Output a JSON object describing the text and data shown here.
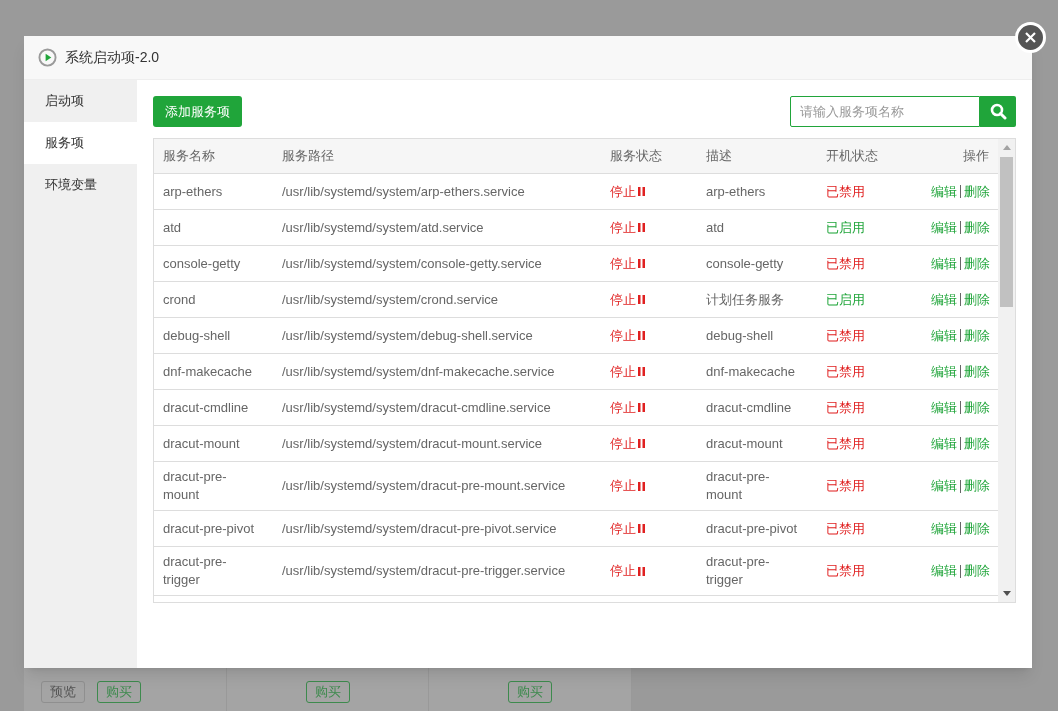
{
  "background": {
    "cards": [
      {
        "buttons": [
          {
            "label": "预览",
            "kind": "plain"
          },
          {
            "label": "购买",
            "kind": "buy"
          }
        ]
      },
      {
        "buttons": [
          {
            "label": "购买",
            "kind": "buy"
          }
        ]
      },
      {
        "buttons": [
          {
            "label": "购买",
            "kind": "buy"
          }
        ]
      }
    ]
  },
  "window": {
    "title": "系统启动项-2.0"
  },
  "sidebar": {
    "items": [
      {
        "label": "启动项",
        "selected": false
      },
      {
        "label": "服务项",
        "selected": true
      },
      {
        "label": "环境变量",
        "selected": false
      }
    ]
  },
  "toolbar": {
    "add_button": "添加服务项",
    "search": {
      "placeholder": "请输入服务项名称"
    }
  },
  "table": {
    "columns": [
      "服务名称",
      "服务路径",
      "服务状态",
      "描述",
      "开机状态",
      "操作"
    ],
    "rows": [
      {
        "name": "arp-ethers",
        "path": "/usr/lib/systemd/system/arp-ethers.service",
        "status": "停止",
        "running": false,
        "description": "arp-ethers",
        "boot": "已禁用",
        "enabled": false,
        "actions": [
          "编辑",
          "删除"
        ]
      },
      {
        "name": "atd",
        "path": "/usr/lib/systemd/system/atd.service",
        "status": "停止",
        "running": false,
        "description": "atd",
        "boot": "已启用",
        "enabled": true,
        "actions": [
          "编辑",
          "删除"
        ]
      },
      {
        "name": "console-getty",
        "path": "/usr/lib/systemd/system/console-getty.service",
        "status": "停止",
        "running": false,
        "description": "console-getty",
        "boot": "已禁用",
        "enabled": false,
        "actions": [
          "编辑",
          "删除"
        ]
      },
      {
        "name": "crond",
        "path": "/usr/lib/systemd/system/crond.service",
        "status": "停止",
        "running": false,
        "description": "计划任务服务",
        "boot": "已启用",
        "enabled": true,
        "actions": [
          "编辑",
          "删除"
        ]
      },
      {
        "name": "debug-shell",
        "path": "/usr/lib/systemd/system/debug-shell.service",
        "status": "停止",
        "running": false,
        "description": "debug-shell",
        "boot": "已禁用",
        "enabled": false,
        "actions": [
          "编辑",
          "删除"
        ]
      },
      {
        "name": "dnf-makecache",
        "path": "/usr/lib/systemd/system/dnf-makecache.service",
        "status": "停止",
        "running": false,
        "description": "dnf-makecache",
        "boot": "已禁用",
        "enabled": false,
        "actions": [
          "编辑",
          "删除"
        ]
      },
      {
        "name": "dracut-cmdline",
        "path": "/usr/lib/systemd/system/dracut-cmdline.service",
        "status": "停止",
        "running": false,
        "description": "dracut-cmdline",
        "boot": "已禁用",
        "enabled": false,
        "actions": [
          "编辑",
          "删除"
        ]
      },
      {
        "name": "dracut-mount",
        "path": "/usr/lib/systemd/system/dracut-mount.service",
        "status": "停止",
        "running": false,
        "description": "dracut-mount",
        "boot": "已禁用",
        "enabled": false,
        "actions": [
          "编辑",
          "删除"
        ]
      },
      {
        "name": "dracut-pre-mount",
        "path": "/usr/lib/systemd/system/dracut-pre-mount.service",
        "status": "停止",
        "running": false,
        "description": "dracut-pre-mount",
        "boot": "已禁用",
        "enabled": false,
        "actions": [
          "编辑",
          "删除"
        ]
      },
      {
        "name": "dracut-pre-pivot",
        "path": "/usr/lib/systemd/system/dracut-pre-pivot.service",
        "status": "停止",
        "running": false,
        "description": "dracut-pre-pivot",
        "boot": "已禁用",
        "enabled": false,
        "actions": [
          "编辑",
          "删除"
        ]
      },
      {
        "name": "dracut-pre-trigger",
        "path": "/usr/lib/systemd/system/dracut-pre-trigger.service",
        "status": "停止",
        "running": false,
        "description": "dracut-pre-trigger",
        "boot": "已禁用",
        "enabled": false,
        "actions": [
          "编辑",
          "删除"
        ]
      }
    ]
  }
}
